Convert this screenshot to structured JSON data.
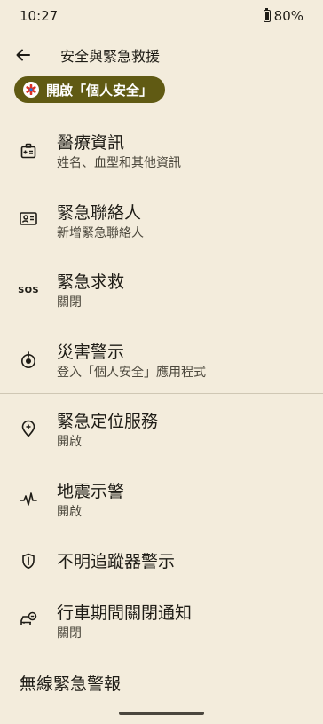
{
  "status_bar": {
    "time": "10:27",
    "battery": "80%"
  },
  "header": {
    "title": "安全與緊急救援"
  },
  "banner": {
    "label": "開啟「個人安全」"
  },
  "items": [
    {
      "title": "醫療資訊",
      "subtitle": "姓名、血型和其他資訊",
      "icon": "medical-id-icon"
    },
    {
      "title": "緊急聯絡人",
      "subtitle": "新增緊急聯絡人",
      "icon": "contact-card-icon"
    },
    {
      "title": "緊急求救",
      "subtitle": "關閉",
      "icon": "sos-icon",
      "icon_text": "SOS"
    },
    {
      "title": "災害警示",
      "subtitle": "登入「個人安全」應用程式",
      "icon": "alert-target-icon"
    },
    {
      "title": "緊急定位服務",
      "subtitle": "開啟",
      "icon": "location-pin-icon"
    },
    {
      "title": "地震示警",
      "subtitle": "開啟",
      "icon": "waveform-icon"
    },
    {
      "title": "不明追蹤器警示",
      "icon": "tracker-shield-icon"
    },
    {
      "title": "行車期間關閉通知",
      "subtitle": "關閉",
      "icon": "car-notification-icon"
    }
  ],
  "section": {
    "title": "無線緊急警報"
  }
}
